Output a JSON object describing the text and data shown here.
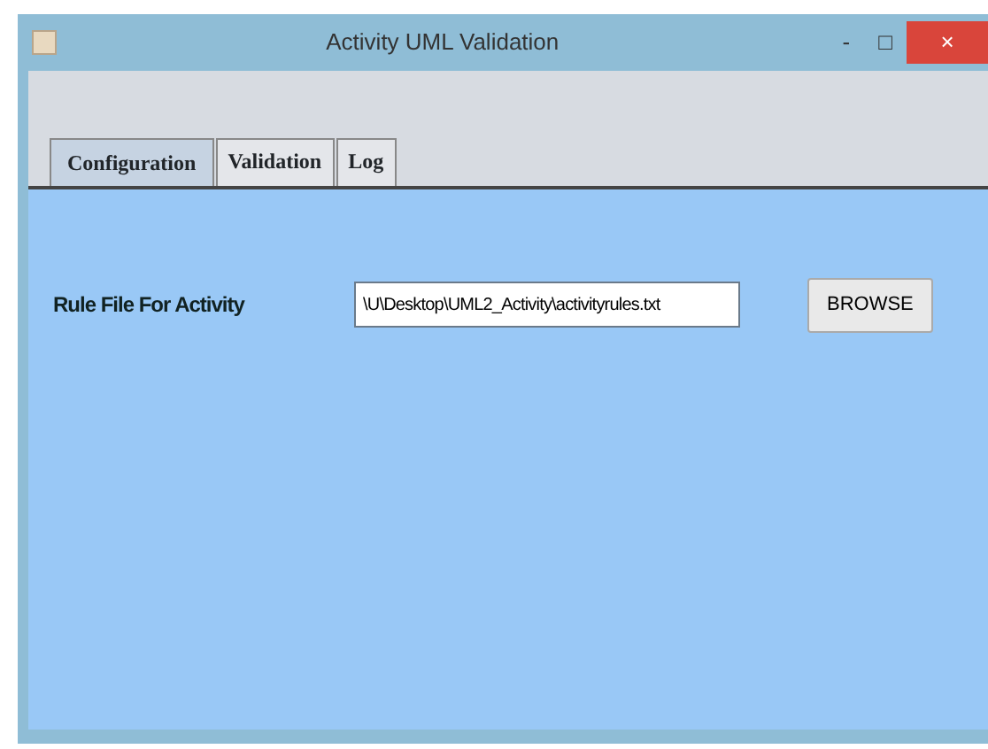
{
  "window": {
    "title": "Activity UML Validation",
    "controls": [
      "-",
      "□",
      "×"
    ]
  },
  "tabs": [
    {
      "label": "Configuration",
      "selected": true
    },
    {
      "label": "Validation",
      "selected": false
    },
    {
      "label": "Log",
      "selected": false
    }
  ],
  "form": {
    "label": "Rule File For Activity",
    "value": "\\U\\Desktop\\UML2_Activity\\activityrules.txt",
    "button": "BROWSE"
  }
}
